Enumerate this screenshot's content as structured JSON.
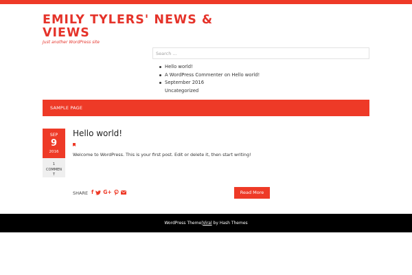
{
  "site": {
    "title": "EMILY TYLERS' NEWS & VIEWS",
    "description": "Just another WordPress site"
  },
  "search": {
    "placeholder": "Search ..."
  },
  "widgets": {
    "items": [
      {
        "label": "Hello world!",
        "bullet": true
      },
      {
        "label": "A WordPress Commenter on Hello world!",
        "bullet": true
      },
      {
        "label": "September 2016",
        "bullet": true
      },
      {
        "label": "Uncategorized",
        "bullet": false
      }
    ]
  },
  "nav": {
    "items": [
      {
        "label": "SAMPLE PAGE"
      }
    ]
  },
  "post": {
    "date_month": "SEP",
    "date_day": "9",
    "date_year": "2016",
    "comment_count": "1",
    "comment_label_1": "COMMEN",
    "comment_label_2": "T",
    "title": "Hello world!",
    "excerpt": "Welcome to WordPress. This is your first post. Edit or delete it, then start writing!",
    "share_label": "SHARE",
    "share_icons": [
      "facebook-icon",
      "twitter-icon",
      "google-plus-icon",
      "pinterest-icon",
      "email-icon"
    ],
    "read_more": "Read More"
  },
  "footer": {
    "text_before": "WordPress Theme",
    "separator": "|",
    "theme_link": "Viral",
    "text_after": " by Hash Themes"
  },
  "colors": {
    "accent": "#ee3a27",
    "footer_bg": "#000000",
    "comment_bg": "#efefef"
  }
}
